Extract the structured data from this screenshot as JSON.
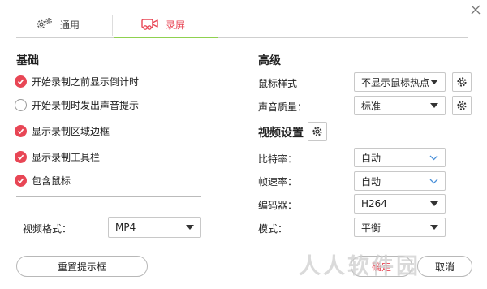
{
  "tabs": [
    {
      "label": "通用",
      "icon": "gears-icon"
    },
    {
      "label": "录屏",
      "icon": "video-camera-icon"
    }
  ],
  "colors": {
    "accent": "#e84655",
    "tab_active": "#e84655",
    "underline": "#8fd14f",
    "caret_blue": "#4a90d9"
  },
  "basic": {
    "title": "基础",
    "options": [
      {
        "label": "开始录制之前显示倒计时",
        "checked": true
      },
      {
        "label": "开始录制时发出声音提示",
        "checked": false
      },
      {
        "label": "显示录制区域边框",
        "checked": true
      },
      {
        "label": "显示录制工具栏",
        "checked": true
      },
      {
        "label": "包含鼠标",
        "checked": true
      }
    ],
    "video_format_label": "视频格式：",
    "video_format_value": "MP4"
  },
  "advanced": {
    "title": "高级",
    "mouse_style_label": "鼠标样式",
    "mouse_style_value": "不显示鼠标热点",
    "audio_quality_label": "声音质量：",
    "audio_quality_value": "标准"
  },
  "video": {
    "title": "视频设置",
    "bitrate_label": "比特率：",
    "bitrate_value": "自动",
    "framerate_label": "帧速率：",
    "framerate_value": "自动",
    "encoder_label": "编码器：",
    "encoder_value": "H264",
    "mode_label": "模式：",
    "mode_value": "平衡"
  },
  "buttons": {
    "reset": "重置提示框",
    "ok": "确定",
    "cancel": "取消"
  },
  "watermark": "人人软件园"
}
